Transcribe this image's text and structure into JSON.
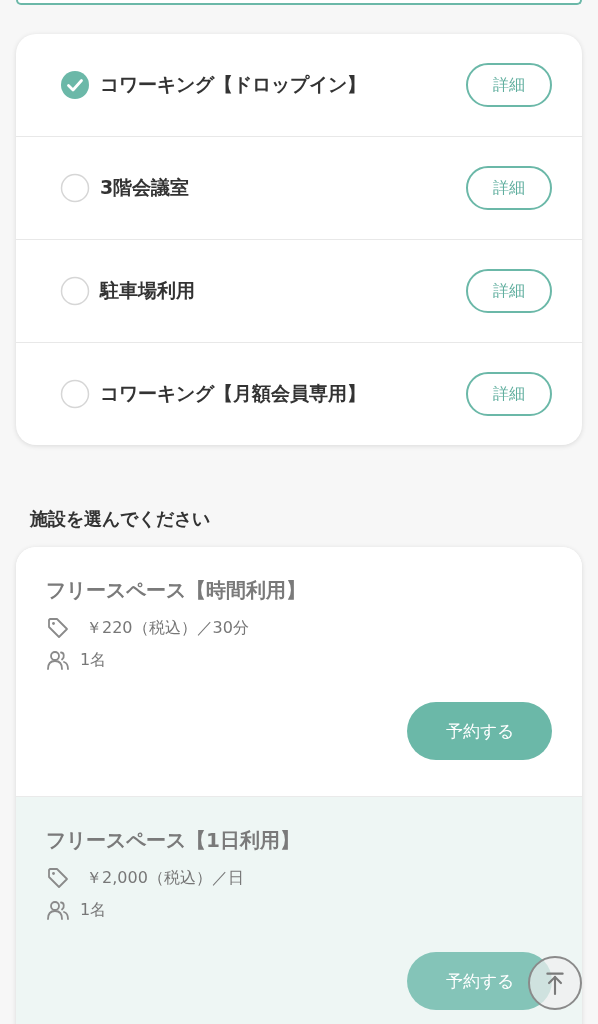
{
  "categories": [
    {
      "label": "コワーキング【ドロップイン】",
      "selected": true,
      "detail_button": "詳細"
    },
    {
      "label": "3階会議室",
      "selected": false,
      "detail_button": "詳細"
    },
    {
      "label": "駐車場利用",
      "selected": false,
      "detail_button": "詳細"
    },
    {
      "label": "コワーキング【月額会員専用】",
      "selected": false,
      "detail_button": "詳細"
    }
  ],
  "facilities_heading": "施設を選んでください",
  "facilities": [
    {
      "name": "フリースペース【時間利用】",
      "price": "￥220（税込）／30分",
      "capacity": "1名",
      "reserve_button": "予約する",
      "highlighted": false
    },
    {
      "name": "フリースペース【1日利用】",
      "price": "￥2,000（税込）／日",
      "capacity": "1名",
      "reserve_button": "予約する",
      "highlighted": true
    }
  ]
}
